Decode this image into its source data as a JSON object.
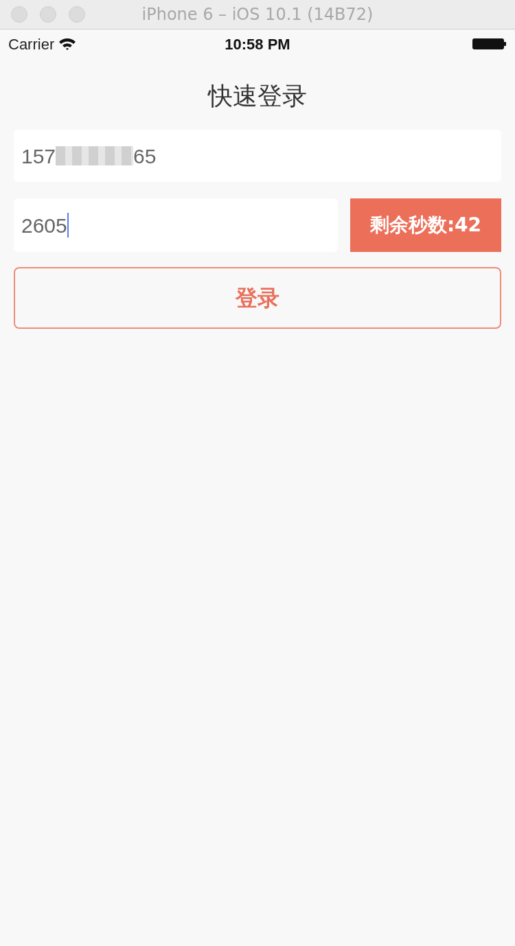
{
  "window": {
    "title": "iPhone 6 – iOS 10.1 (14B72)"
  },
  "status_bar": {
    "carrier": "Carrier",
    "time": "10:58 PM"
  },
  "page_title": "快速登录",
  "phone_field": {
    "value_start": "157",
    "value_end": "65",
    "redacted": true
  },
  "code_field": {
    "value": "2605",
    "focused": true
  },
  "countdown_button": {
    "label": "剩余秒数:42"
  },
  "login_button": {
    "label": "登录"
  }
}
